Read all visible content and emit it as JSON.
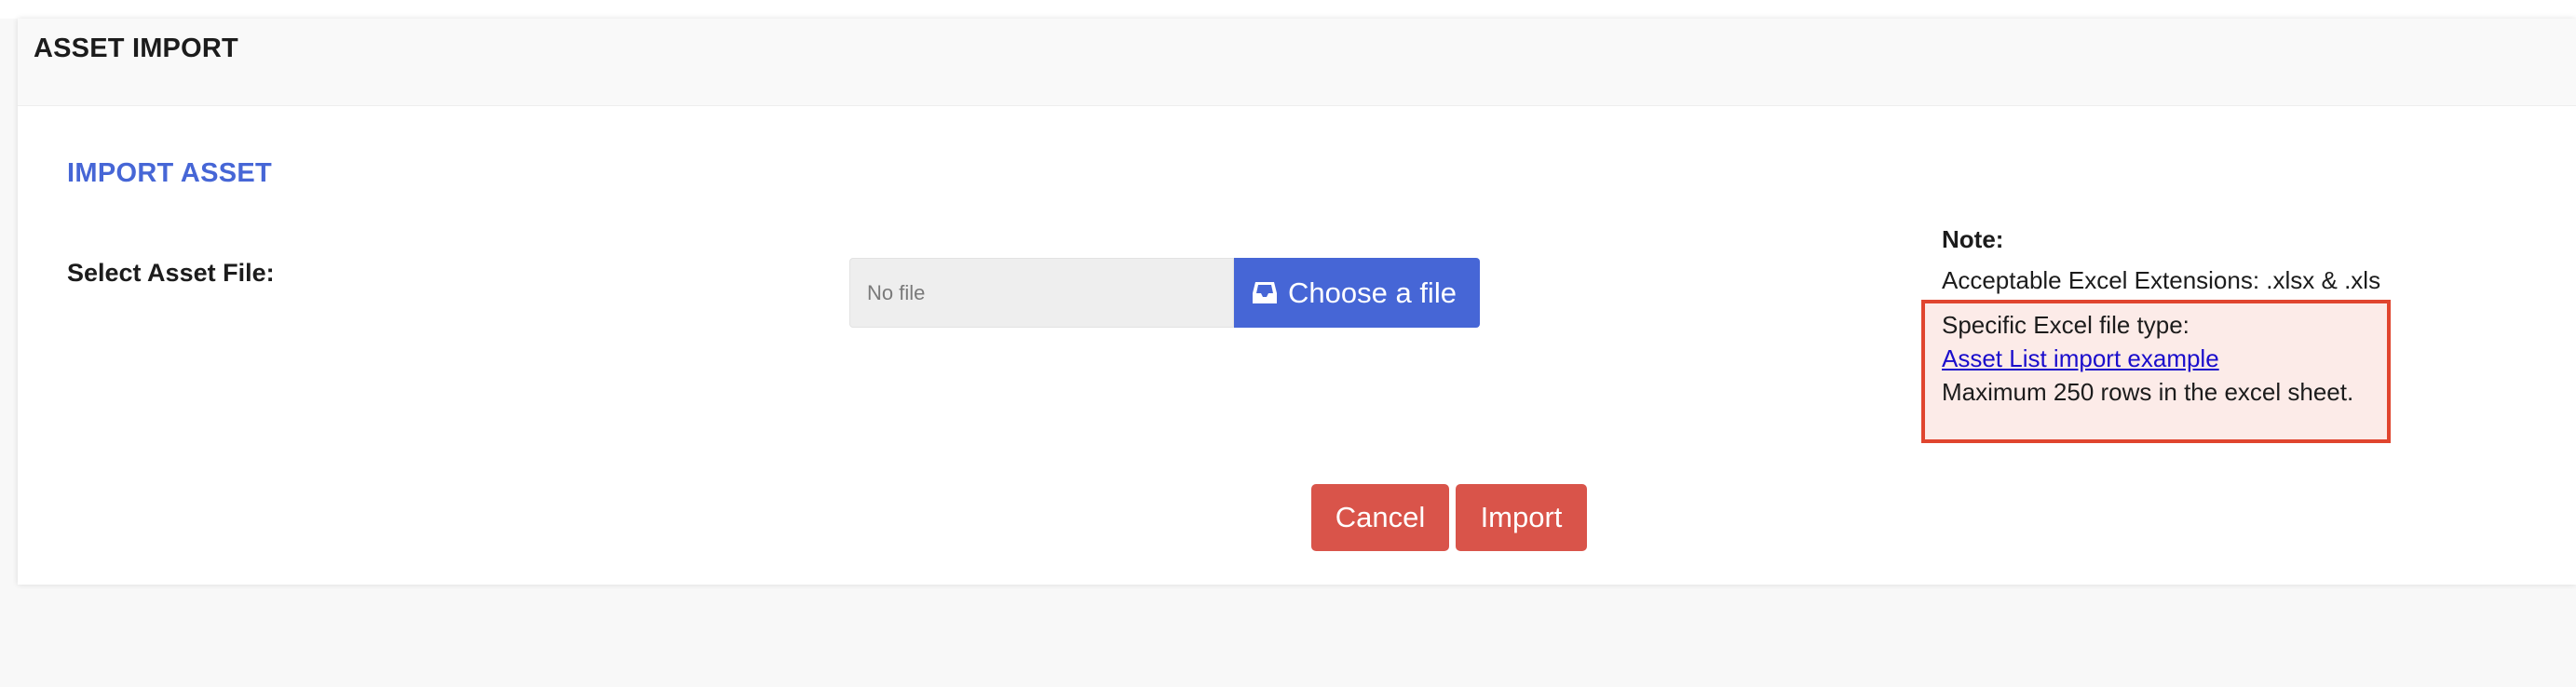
{
  "header": {
    "title": "ASSET IMPORT"
  },
  "section": {
    "title": "IMPORT ASSET"
  },
  "form": {
    "file_label": "Select Asset File:",
    "file_value": "No file",
    "choose_label": "Choose a file",
    "choose_icon": "inbox-icon"
  },
  "note": {
    "title": "Note:",
    "extensions": "Acceptable Excel Extensions: .xlsx & .xls",
    "file_type": "Specific Excel file type:",
    "example_link": "Asset List import example",
    "max_rows": "Maximum 250 rows in the excel sheet."
  },
  "actions": {
    "cancel_label": "Cancel",
    "import_label": "Import"
  },
  "colors": {
    "accent": "#4666d6",
    "danger": "#d9544a",
    "highlight_border": "#e0452f",
    "highlight_bg": "#fcebe8",
    "link": "#1a0dcc"
  }
}
